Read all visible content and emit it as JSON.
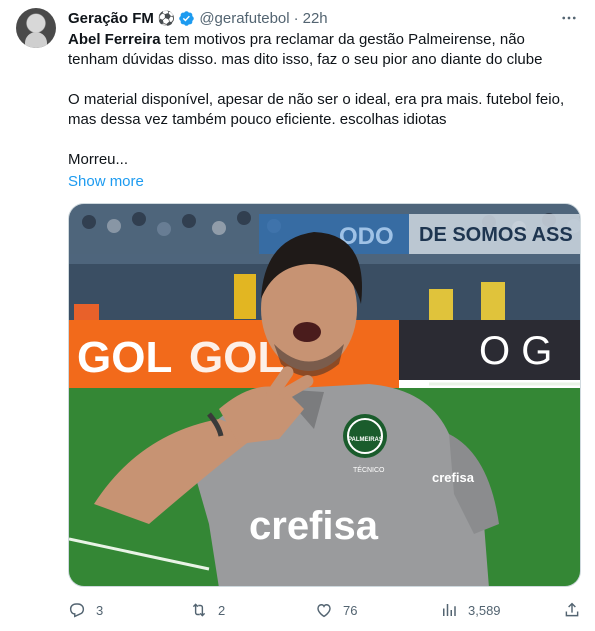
{
  "author": {
    "name": "Geração FM",
    "badge_icon": "soccer-ball-icon",
    "verified_icon": "verified-badge-icon",
    "handle": "@gerafutebol",
    "separator": "·",
    "time": "22h"
  },
  "tweet": {
    "line1_bold": "Abel Ferreira",
    "line1_rest": " tem motivos pra reclamar da gestão Palmeirense, não tenham dúvidas disso. mas dito isso, faz o seu pior ano diante do clube",
    "paragraph2": "O material disponível, apesar de não ser o ideal, era pra mais. futebol feio, mas dessa vez também pouco eficiente. escolhas idiotas",
    "paragraph3": "Morreu...",
    "show_more": "Show more"
  },
  "media": {
    "ad_board_left": "GOL",
    "ad_board_left_2": "GOL",
    "ad_board_right": "O G",
    "banner_text": "DE SOMOS ASS",
    "banner_text_2": "ODO",
    "shirt_sponsor": "crefisa",
    "sleeve_sponsor": "crefisa",
    "crest_text": "PALMEIRAS",
    "crest_sub": "TÉCNICO"
  },
  "actions": {
    "reply_count": "3",
    "retweet_count": "2",
    "like_count": "76",
    "views_count": "3,589"
  },
  "colors": {
    "link": "#1d9bf0",
    "muted": "#536471",
    "verified": "#1d9bf0",
    "pitch": "#2f7d32",
    "ad_orange": "#f26a1b",
    "shirt": "#9a9b9d"
  }
}
